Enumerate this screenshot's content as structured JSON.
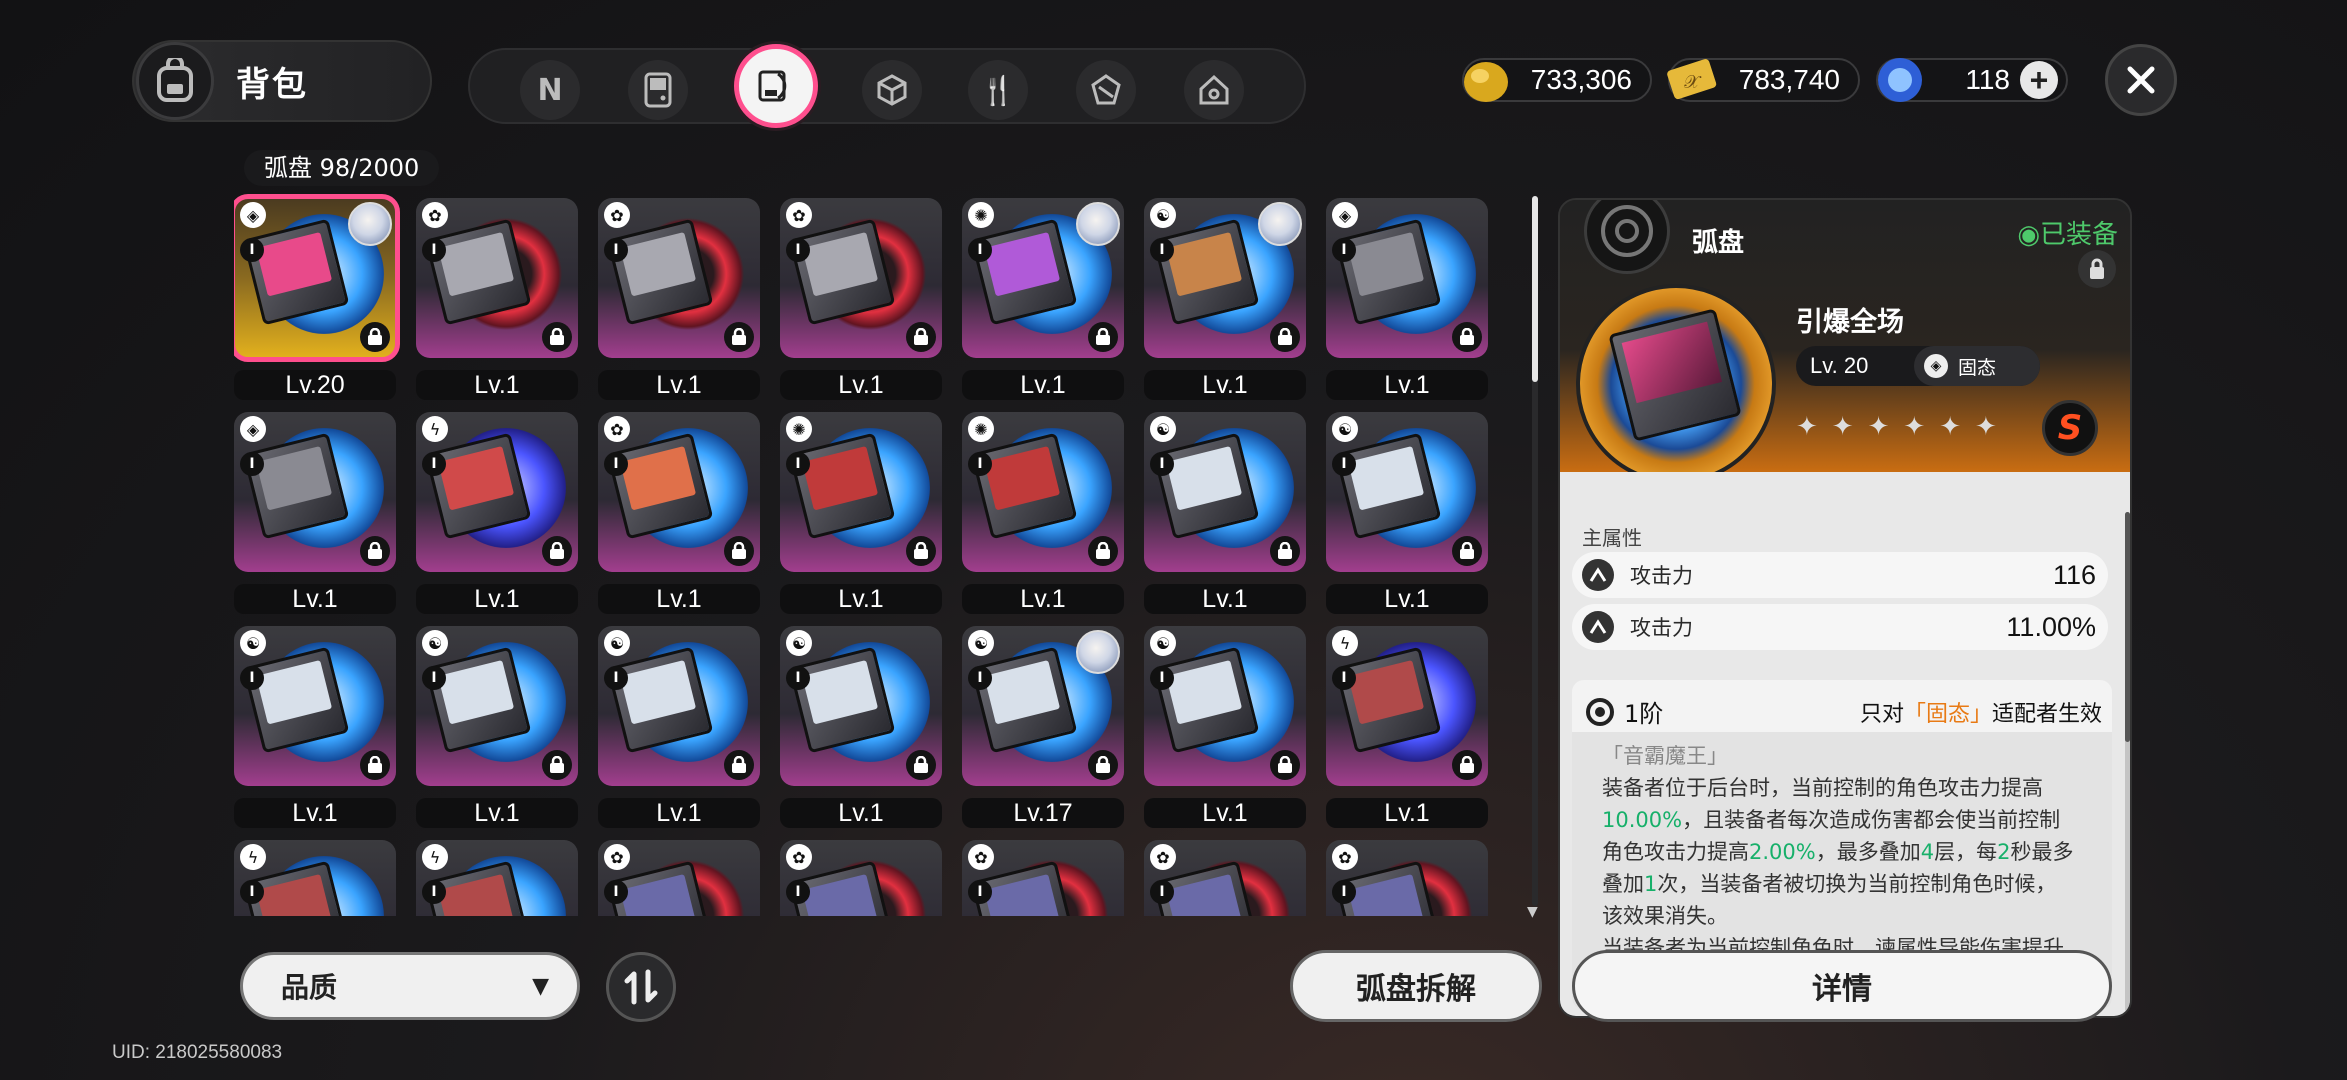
{
  "header": {
    "title": "背包",
    "tabs": [
      {
        "name": "tab-weapons",
        "icon": "n-logo-icon"
      },
      {
        "name": "tab-devices",
        "icon": "handheld-icon"
      },
      {
        "name": "tab-discs",
        "icon": "disc-icon",
        "active": true
      },
      {
        "name": "tab-materials",
        "icon": "cube-icon"
      },
      {
        "name": "tab-food",
        "icon": "fork-spoon-icon"
      },
      {
        "name": "tab-shards",
        "icon": "crystal-icon"
      },
      {
        "name": "tab-home",
        "icon": "house-icon"
      }
    ],
    "currencies": [
      {
        "name": "gold-currency",
        "value": "733,306",
        "icon": "gold-nugget-icon"
      },
      {
        "name": "ticket-currency",
        "value": "783,740",
        "icon": "ticket-icon"
      },
      {
        "name": "crystal-currency",
        "value": "118",
        "icon": "blue-crystal-icon",
        "has_plus": true
      }
    ]
  },
  "inventory": {
    "count_label": "弧盘  98/2000",
    "items": [
      {
        "lv": "Lv.20",
        "disc": "blue",
        "art": "#e84a8a",
        "type": "◈",
        "avatar": true,
        "selected": true,
        "bg": "gold"
      },
      {
        "lv": "Lv.1",
        "disc": "red",
        "art": "#a8a8b0",
        "type": "✿"
      },
      {
        "lv": "Lv.1",
        "disc": "red",
        "art": "#a8a8b0",
        "type": "✿"
      },
      {
        "lv": "Lv.1",
        "disc": "red",
        "art": "#a8a8b0",
        "type": "✿"
      },
      {
        "lv": "Lv.1",
        "disc": "blue",
        "art": "#b05ad8",
        "type": "✺",
        "avatar": true
      },
      {
        "lv": "Lv.1",
        "disc": "blue",
        "art": "#c8844a",
        "type": "☯",
        "avatar": true
      },
      {
        "lv": "Lv.1",
        "disc": "blue",
        "art": "#8a8a92",
        "type": "◈"
      },
      {
        "lv": "Lv.1",
        "disc": "blue",
        "art": "#8a8a92",
        "type": "◈"
      },
      {
        "lv": "Lv.1",
        "disc": "violet",
        "art": "#d04a4a",
        "type": "ϟ"
      },
      {
        "lv": "Lv.1",
        "disc": "blue",
        "art": "#e0704a",
        "type": "✿"
      },
      {
        "lv": "Lv.1",
        "disc": "blue",
        "art": "#c03a3a",
        "type": "✺"
      },
      {
        "lv": "Lv.1",
        "disc": "blue",
        "art": "#c03a3a",
        "type": "✺"
      },
      {
        "lv": "Lv.1",
        "disc": "blue",
        "art": "#d8e0ea",
        "type": "☯"
      },
      {
        "lv": "Lv.1",
        "disc": "blue",
        "art": "#d8e0ea",
        "type": "☯"
      },
      {
        "lv": "Lv.1",
        "disc": "blue",
        "art": "#d8e0ea",
        "type": "☯"
      },
      {
        "lv": "Lv.1",
        "disc": "blue",
        "art": "#d8e0ea",
        "type": "☯"
      },
      {
        "lv": "Lv.1",
        "disc": "blue",
        "art": "#d8e0ea",
        "type": "☯"
      },
      {
        "lv": "Lv.1",
        "disc": "blue",
        "art": "#d8e0ea",
        "type": "☯"
      },
      {
        "lv": "Lv.17",
        "disc": "blue",
        "art": "#d8e0ea",
        "type": "☯",
        "avatar": true
      },
      {
        "lv": "Lv.1",
        "disc": "blue",
        "art": "#d8e0ea",
        "type": "☯"
      },
      {
        "lv": "Lv.1",
        "disc": "violet",
        "art": "#b04a4a",
        "type": "ϟ"
      },
      {
        "lv": "",
        "disc": "blue",
        "art": "#b04a4a",
        "type": "ϟ"
      },
      {
        "lv": "",
        "disc": "blue",
        "art": "#b04a4a",
        "type": "ϟ"
      },
      {
        "lv": "",
        "disc": "red",
        "art": "#6a6aa8",
        "type": "✿"
      },
      {
        "lv": "",
        "disc": "red",
        "art": "#6a6aa8",
        "type": "✿"
      },
      {
        "lv": "",
        "disc": "red",
        "art": "#6a6aa8",
        "type": "✿"
      },
      {
        "lv": "",
        "disc": "red",
        "art": "#6a6aa8",
        "type": "✿"
      },
      {
        "lv": "",
        "disc": "red",
        "art": "#6a6aa8",
        "type": "✿"
      }
    ]
  },
  "controls": {
    "quality_label": "品质",
    "dismantle_label": "弧盘拆解",
    "details_label": "详情"
  },
  "uid": "UID: 218025580083",
  "detail": {
    "type_label": "弧盘",
    "equipped_label": "◉已装备",
    "name": "引爆全场",
    "level": "Lv. 20",
    "attribute": "固态",
    "rank": "S",
    "section_title": "主属性",
    "stats": [
      {
        "label": "攻击力",
        "value": "116"
      },
      {
        "label": "攻击力",
        "value": "11.00%"
      }
    ],
    "skill": {
      "tier": "1阶",
      "cond_prefix": "只对",
      "cond_highlight": "「固态」",
      "cond_suffix": "适配者生效",
      "name": "「音霸魔王」",
      "lines": [
        "装备者位于后台时，当前控制的角色攻击力提高",
        "10.00%|，且装备者每次造成伤害都会使当前控制",
        "角色攻击力提高|2.00%|，最多叠加|4|层，每|2|秒最多",
        "叠加|1|次，当装备者被切换为当前控制角色时候，",
        "该效果消失。",
        "当装备者为当前控制角色时，谏属性导能伤害提升"
      ]
    }
  },
  "colors": {
    "accent_pink": "#ff4f8e",
    "equipped_green": "#4ec96b",
    "highlight_orange": "#e87a14",
    "value_green": "#17b06a"
  }
}
